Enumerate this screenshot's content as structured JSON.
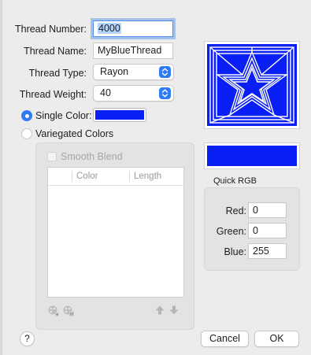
{
  "form": {
    "thread_number_label": "Thread Number:",
    "thread_number_value": "4000",
    "thread_name_label": "Thread Name:",
    "thread_name_value": "MyBlueThread",
    "thread_type_label": "Thread Type:",
    "thread_type_value": "Rayon",
    "thread_weight_label": "Thread Weight:",
    "thread_weight_value": "40"
  },
  "color_mode": {
    "single_label": "Single Color:",
    "single_selected": true,
    "single_color": "#0a1ff5",
    "variegated_label": "Variegated Colors",
    "variegated_selected": false
  },
  "variegated": {
    "smooth_blend_label": "Smooth Blend",
    "smooth_blend_checked": false,
    "columns": [
      "Color",
      "Length"
    ],
    "add_icon": "add-color-icon",
    "remove_icon": "remove-color-icon",
    "up_icon": "arrow-up-icon",
    "down_icon": "arrow-down-icon"
  },
  "preview": {
    "accent": "#0a1ff5",
    "swatch_color": "#0a1ff5"
  },
  "quick_rgb": {
    "title": "Quick RGB",
    "red_label": "Red:",
    "red_value": "0",
    "green_label": "Green:",
    "green_value": "0",
    "blue_label": "Blue:",
    "blue_value": "255"
  },
  "footer": {
    "help_label": "?",
    "cancel_label": "Cancel",
    "ok_label": "OK"
  }
}
